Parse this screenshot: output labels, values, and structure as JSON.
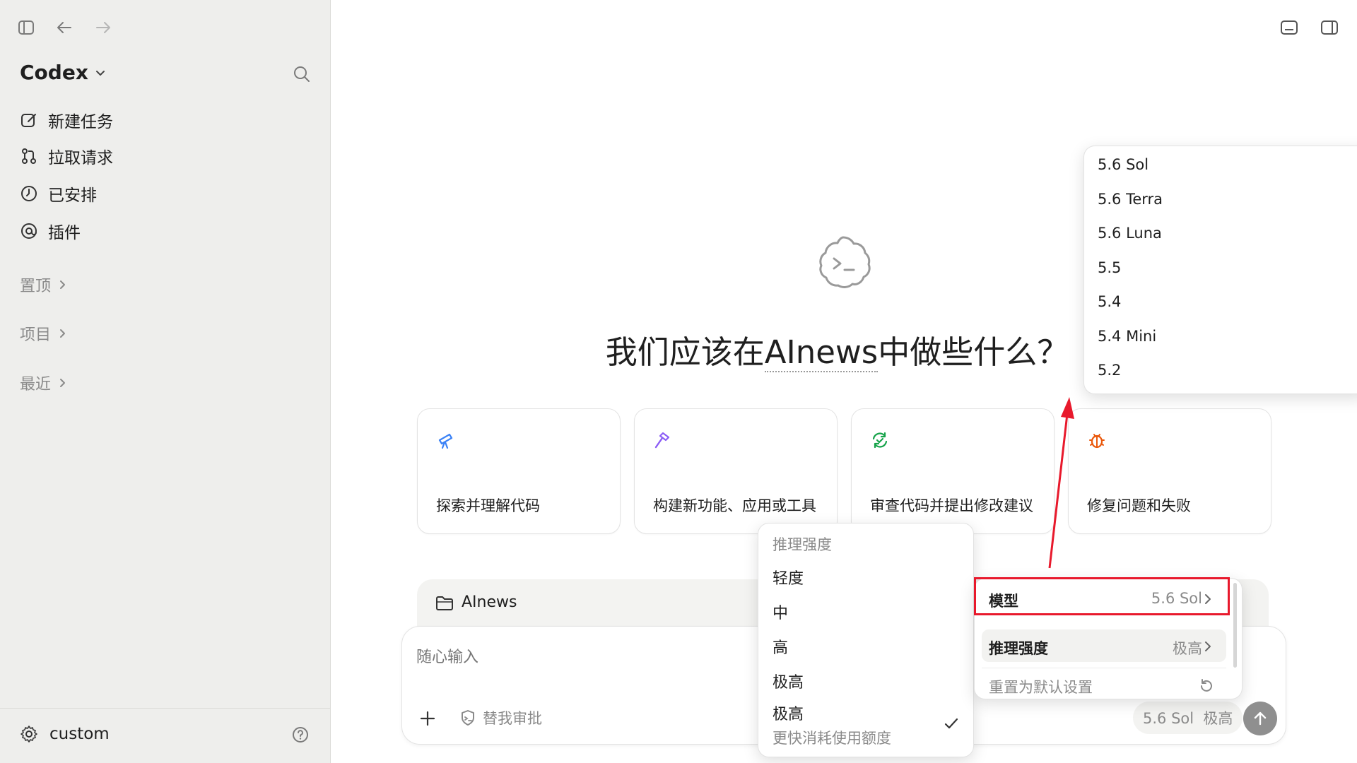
{
  "sidebar": {
    "app_title": "Codex",
    "nav": [
      {
        "label": "新建任务",
        "icon": "edit-icon"
      },
      {
        "label": "拉取请求",
        "icon": "pull-request-icon"
      },
      {
        "label": "已安排",
        "icon": "clock-icon"
      },
      {
        "label": "插件",
        "icon": "plugin-icon"
      }
    ],
    "sections": [
      {
        "label": "置顶"
      },
      {
        "label": "项目"
      },
      {
        "label": "最近"
      }
    ],
    "footer": {
      "settings_label": "custom"
    }
  },
  "main": {
    "heading_prefix": "我们应该在",
    "heading_project": "AInews",
    "heading_suffix": "中做些什么？",
    "cards": [
      {
        "label": "探索并理解代码",
        "icon": "telescope-icon",
        "color": "#3b82f6"
      },
      {
        "label": "构建新功能、应用或工具",
        "icon": "hammer-icon",
        "color": "#8b5cf6"
      },
      {
        "label": "审查代码并提出修改建议",
        "icon": "review-icon",
        "color": "#16a34a"
      },
      {
        "label": "修复问题和失败",
        "icon": "bug-icon",
        "color": "#ea580c"
      }
    ]
  },
  "composer": {
    "project_label": "AInews",
    "placeholder": "随心输入",
    "approval_label": "替我审批",
    "model_chip": "5.6 Sol  极高"
  },
  "reasoning_menu": {
    "header": "推理强度",
    "items": [
      {
        "label": "轻度"
      },
      {
        "label": "中"
      },
      {
        "label": "高"
      },
      {
        "label": "极高"
      },
      {
        "label": "极高",
        "sub": "更快消耗使用额度",
        "selected": true
      }
    ]
  },
  "settings_menu": {
    "model_label": "模型",
    "model_value": "5.6 Sol",
    "reasoning_label": "推理强度",
    "reasoning_value": "极高",
    "reset_label": "重置为默认设置"
  },
  "model_menu": {
    "items": [
      "5.6 Sol",
      "5.6 Terra",
      "5.6 Luna",
      "5.5",
      "5.4",
      "5.4 Mini",
      "5.2"
    ]
  },
  "colors": {
    "highlight": "#e8192c",
    "sidebar_bg": "#eeeeec"
  }
}
